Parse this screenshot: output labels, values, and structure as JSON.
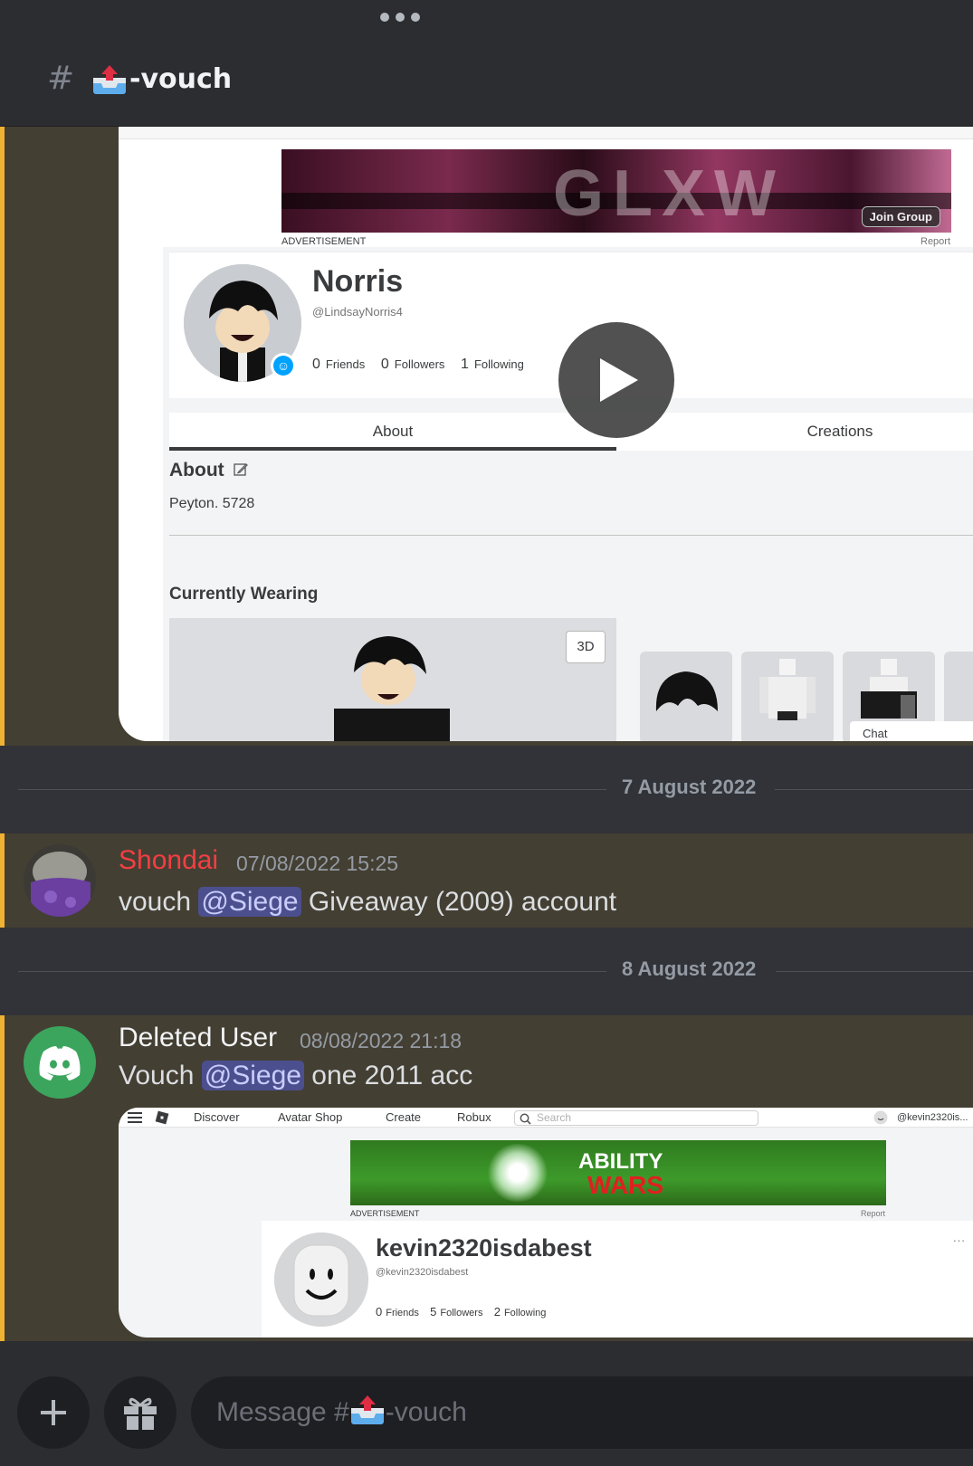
{
  "channel": {
    "hash": "#",
    "name": "-vouch",
    "emoji_icon": "outbox-tray-icon"
  },
  "embed1": {
    "ad_label": "ADVERTISEMENT",
    "report": "Report",
    "join_group": "Join Group",
    "profile": {
      "display_name": "Norris",
      "handle": "@LindsayNorris4",
      "friends_count": "0",
      "friends_label": "Friends",
      "followers_count": "0",
      "followers_label": "Followers",
      "following_count": "1",
      "following_label": "Following"
    },
    "tabs": [
      "About",
      "Creations"
    ],
    "about_heading": "About",
    "about_text": "Peyton. 5728",
    "currently_wearing": "Currently Wearing",
    "btn_3d": "3D",
    "chat": "Chat"
  },
  "dividers": [
    "7 August 2022",
    "8 August 2022"
  ],
  "messages": [
    {
      "author": "Shondai",
      "author_color": "#f23f43",
      "timestamp": "07/08/2022 15:25",
      "before": "vouch ",
      "mention": "@Siege",
      "after": " Giveaway (2009) account"
    },
    {
      "author": "Deleted User",
      "author_color": "#f2f3f5",
      "timestamp": "08/08/2022 21:18",
      "before": "Vouch ",
      "mention": "@Siege",
      "after": " one 2011 acc"
    }
  ],
  "embed2": {
    "nav": [
      "Discover",
      "Avatar Shop",
      "Create",
      "Robux"
    ],
    "search_placeholder": "Search",
    "user_tag": "@kevin2320is...",
    "ad_line1": "ABILITY",
    "ad_line2": "WARS",
    "ad_label": "ADVERTISEMENT",
    "report": "Report",
    "profile": {
      "display_name": "kevin2320isdabest",
      "handle": "@kevin2320isdabest",
      "friends_count": "0",
      "friends_label": "Friends",
      "followers_count": "5",
      "followers_label": "Followers",
      "following_count": "2",
      "following_label": "Following"
    },
    "more": "..."
  },
  "composer": {
    "placeholder_prefix": "Message #",
    "placeholder_suffix": "-vouch"
  },
  "colors": {
    "background": "#313338",
    "highlight": "#443f33",
    "highlight_bar": "#f0b232",
    "mention_bg": "#4c4f8e",
    "discord_green": "#3ba55d"
  }
}
